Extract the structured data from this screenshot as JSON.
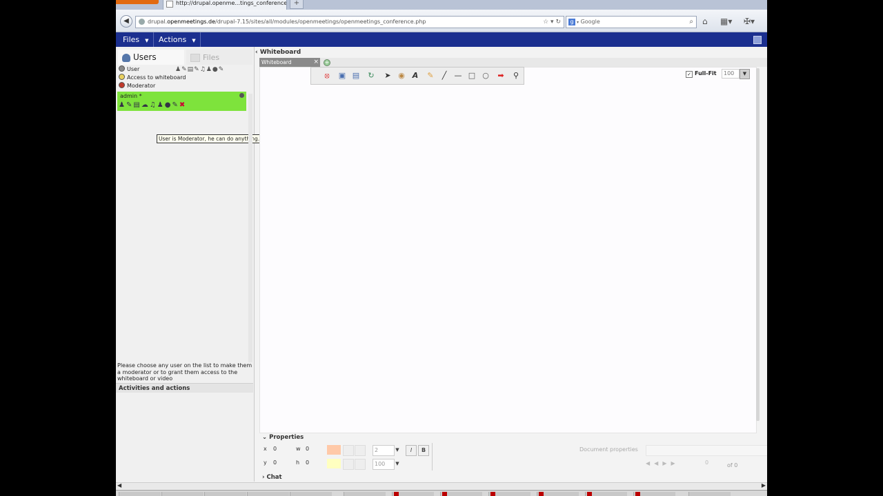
{
  "browser": {
    "tab_title": "http://drupal.openme...tings_conference.php",
    "newtab_label": "+",
    "url_domain_prefix": "drupal.",
    "url_domain_main": "openmeetings.de",
    "url_path": "/drupal-7.15/sites/all/modules/openmeetings/openmeetings_conference.php",
    "search_engine": "Google",
    "search_placeholder": "Google"
  },
  "app": {
    "menu": [
      {
        "label": "Files"
      },
      {
        "label": "Actions"
      }
    ],
    "left_tabs": {
      "users": "Users",
      "files": "Files"
    },
    "legend": [
      {
        "label": "User",
        "color": "#8a8a8a"
      },
      {
        "label": "Access to whiteboard",
        "color": "#e8d060"
      },
      {
        "label": "Moderator",
        "color": "#c0392b"
      }
    ],
    "user_row": {
      "name": "admin",
      "marker": "*",
      "highlight_color": "#7ee33c"
    },
    "tooltip": "User is Moderator, he can do anything.",
    "hint": "Please choose any user on the list to make them a moderator or to grant them access to the whiteboard or video",
    "activities_label": "Activities and actions",
    "whiteboard": {
      "title": "Whiteboard",
      "tab_label": "Whiteboard",
      "tab_close": "×",
      "fullfit_label": "Full-Fit",
      "fullfit_checked": true,
      "zoom_value": "100"
    },
    "properties": {
      "title": "Properties",
      "x_label": "x",
      "x_value": "0",
      "w_label": "w",
      "w_value": "0",
      "y_label": "y",
      "y_value": "0",
      "h_label": "h",
      "h_value": "0",
      "line_width": "2",
      "opacity": "100",
      "italic_label": "I",
      "bold_label": "B",
      "doc_props_label": "Document properties",
      "page_current": "0",
      "page_of": "of 0",
      "line_color": "#ffc9a8",
      "fill_color": "#ffffc0"
    },
    "chat_label": "Chat"
  }
}
